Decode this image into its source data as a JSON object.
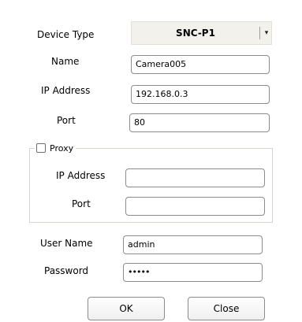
{
  "dialog": {
    "device_type": {
      "label": "Device Type",
      "value": "SNC-P1",
      "arrow": "▾"
    },
    "name": {
      "label": "Name",
      "value": "Camera005"
    },
    "ip_address": {
      "label": "IP Address",
      "value": "192.168.0.3"
    },
    "port": {
      "label": "Port",
      "value": "80"
    },
    "proxy": {
      "label": "Proxy",
      "checked": false,
      "ip_address": {
        "label": "IP Address",
        "value": ""
      },
      "port": {
        "label": "Port",
        "value": ""
      }
    },
    "user_name": {
      "label": "User Name",
      "value": "admin"
    },
    "password": {
      "label": "Password",
      "value": "•••••"
    },
    "buttons": {
      "ok": "OK",
      "close": "Close"
    }
  }
}
